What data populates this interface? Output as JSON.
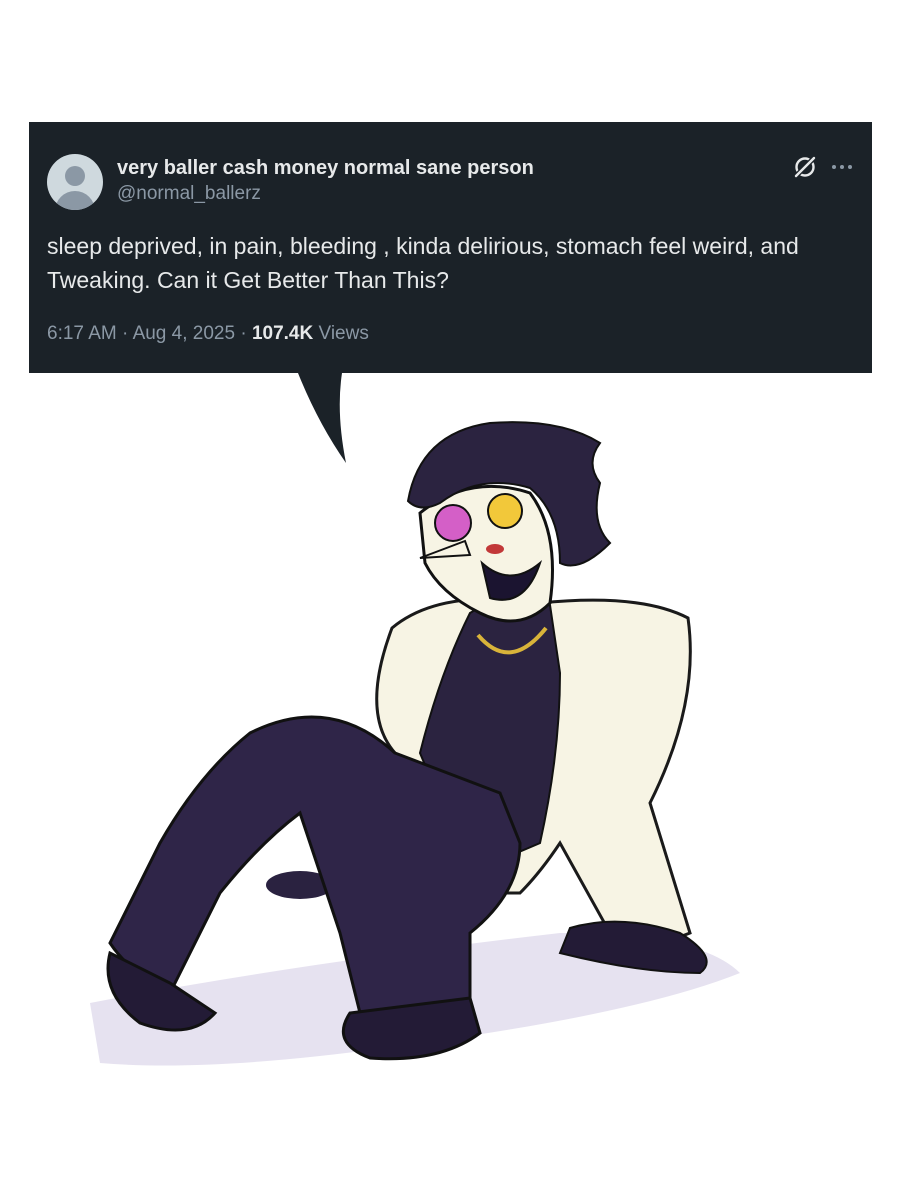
{
  "tweet": {
    "display_name": "very baller cash money normal sane person",
    "handle": "@normal_ballerz",
    "text": "sleep deprived, in pain, bleeding , kinda delirious, stomach feel weird, and Tweaking. Can it Get Better Than This?",
    "time": "6:17 AM",
    "date": "Aug 4, 2025",
    "separator": "·",
    "views_count": "107.4K",
    "views_label": "Views"
  },
  "icons": {
    "avatar": "default-avatar-icon",
    "grok": "grok-icon",
    "more": "more-options-icon"
  },
  "colors": {
    "card_background": "#1b2228",
    "text_primary": "#e7e9ea",
    "text_secondary": "#8b98a5"
  }
}
